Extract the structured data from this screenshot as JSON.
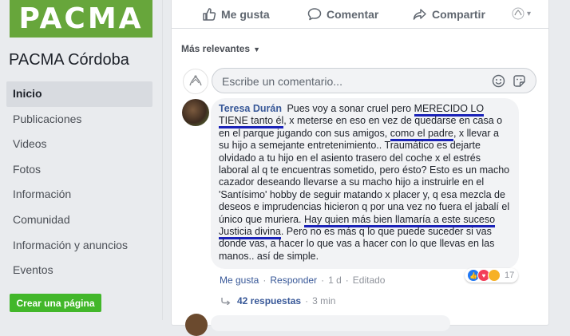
{
  "sidebar": {
    "logo_text": "PACMA",
    "page_name": "PACMA Córdoba",
    "items": [
      {
        "label": "Inicio"
      },
      {
        "label": "Publicaciones"
      },
      {
        "label": "Videos"
      },
      {
        "label": "Fotos"
      },
      {
        "label": "Información"
      },
      {
        "label": "Comunidad"
      },
      {
        "label": "Información y anuncios"
      },
      {
        "label": "Eventos"
      }
    ],
    "create_page_label": "Crear una página"
  },
  "post": {
    "actions": {
      "like": "Me gusta",
      "comment": "Comentar",
      "share": "Compartir"
    },
    "sort_label": "Más relevantes",
    "composer": {
      "placeholder": "Escribe un comentario..."
    },
    "comment": {
      "author": "Teresa Durán",
      "text_parts": [
        " Pues voy a sonar cruel pero ",
        "MERECIDO LO TIENE tanto él",
        ", x meterse en eso en vez de quedarse en casa o en el parque jugando con sus amigos, ",
        "como el padre",
        ", x llevar a su hijo a semejante entretenimiento.. Traumático es dejarte olvidado a tu hijo en el asiento trasero del coche x el estrés laboral al q te encuentras sometido, pero ésto? Esto es un macho cazador deseando llevarse a su macho hijo a instruirle en el 'Santísimo' hobby de seguir matando x placer y, q esa mezcla de deseos e imprudencias hicieron q por una vez no fuera el jabalí el único que muriera. ",
        "Hay quien más bien llamaría a este suceso Justicia divina",
        ". Pero no es más q lo que puede suceder si vas donde vas, a hacer lo que vas a hacer con lo que llevas en las manos.. así de simple."
      ],
      "reaction_count": "17",
      "meta": {
        "like": "Me gusta",
        "reply": "Responder",
        "time": "1 d",
        "edited": "Editado"
      }
    },
    "replies": {
      "label": "42 respuestas",
      "time": "3 min"
    }
  },
  "colors": {
    "brand_green": "#67a63b",
    "create_button": "#42b72a",
    "link_blue": "#385898",
    "annotation_underline": "#1a22b8"
  }
}
